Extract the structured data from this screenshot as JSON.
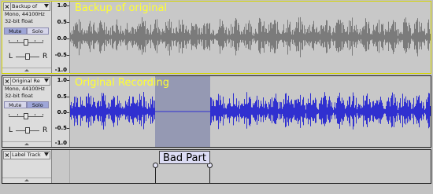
{
  "tracks": [
    {
      "name": "Backup of",
      "title": "Backup of original",
      "rate": "Mono, 44100Hz",
      "format": "32-bit float",
      "mute_label": "Mute",
      "solo_label": "Solo",
      "scale": [
        "1.0",
        "0.5",
        "0.0",
        "-0.5",
        "-1.0"
      ],
      "wave_color": "#7b7b7b",
      "selected": true
    },
    {
      "name": "Original Re",
      "title": "Original Recording",
      "rate": "Mono, 44100Hz",
      "format": "32-bit float",
      "mute_label": "Mute",
      "solo_label": "Solo",
      "scale": [
        "1.0",
        "0.5",
        "0.0",
        "-0.5",
        "-1.0"
      ],
      "wave_color": "#3030d0",
      "selected": false
    }
  ],
  "label_track": {
    "name": "Label Track",
    "label_text": "Bad Part"
  },
  "pan": {
    "left": "L",
    "right": "R"
  },
  "colors": {
    "title_text": "#ffff30",
    "selection": "#9599b3",
    "background": "#c2c2c2"
  }
}
